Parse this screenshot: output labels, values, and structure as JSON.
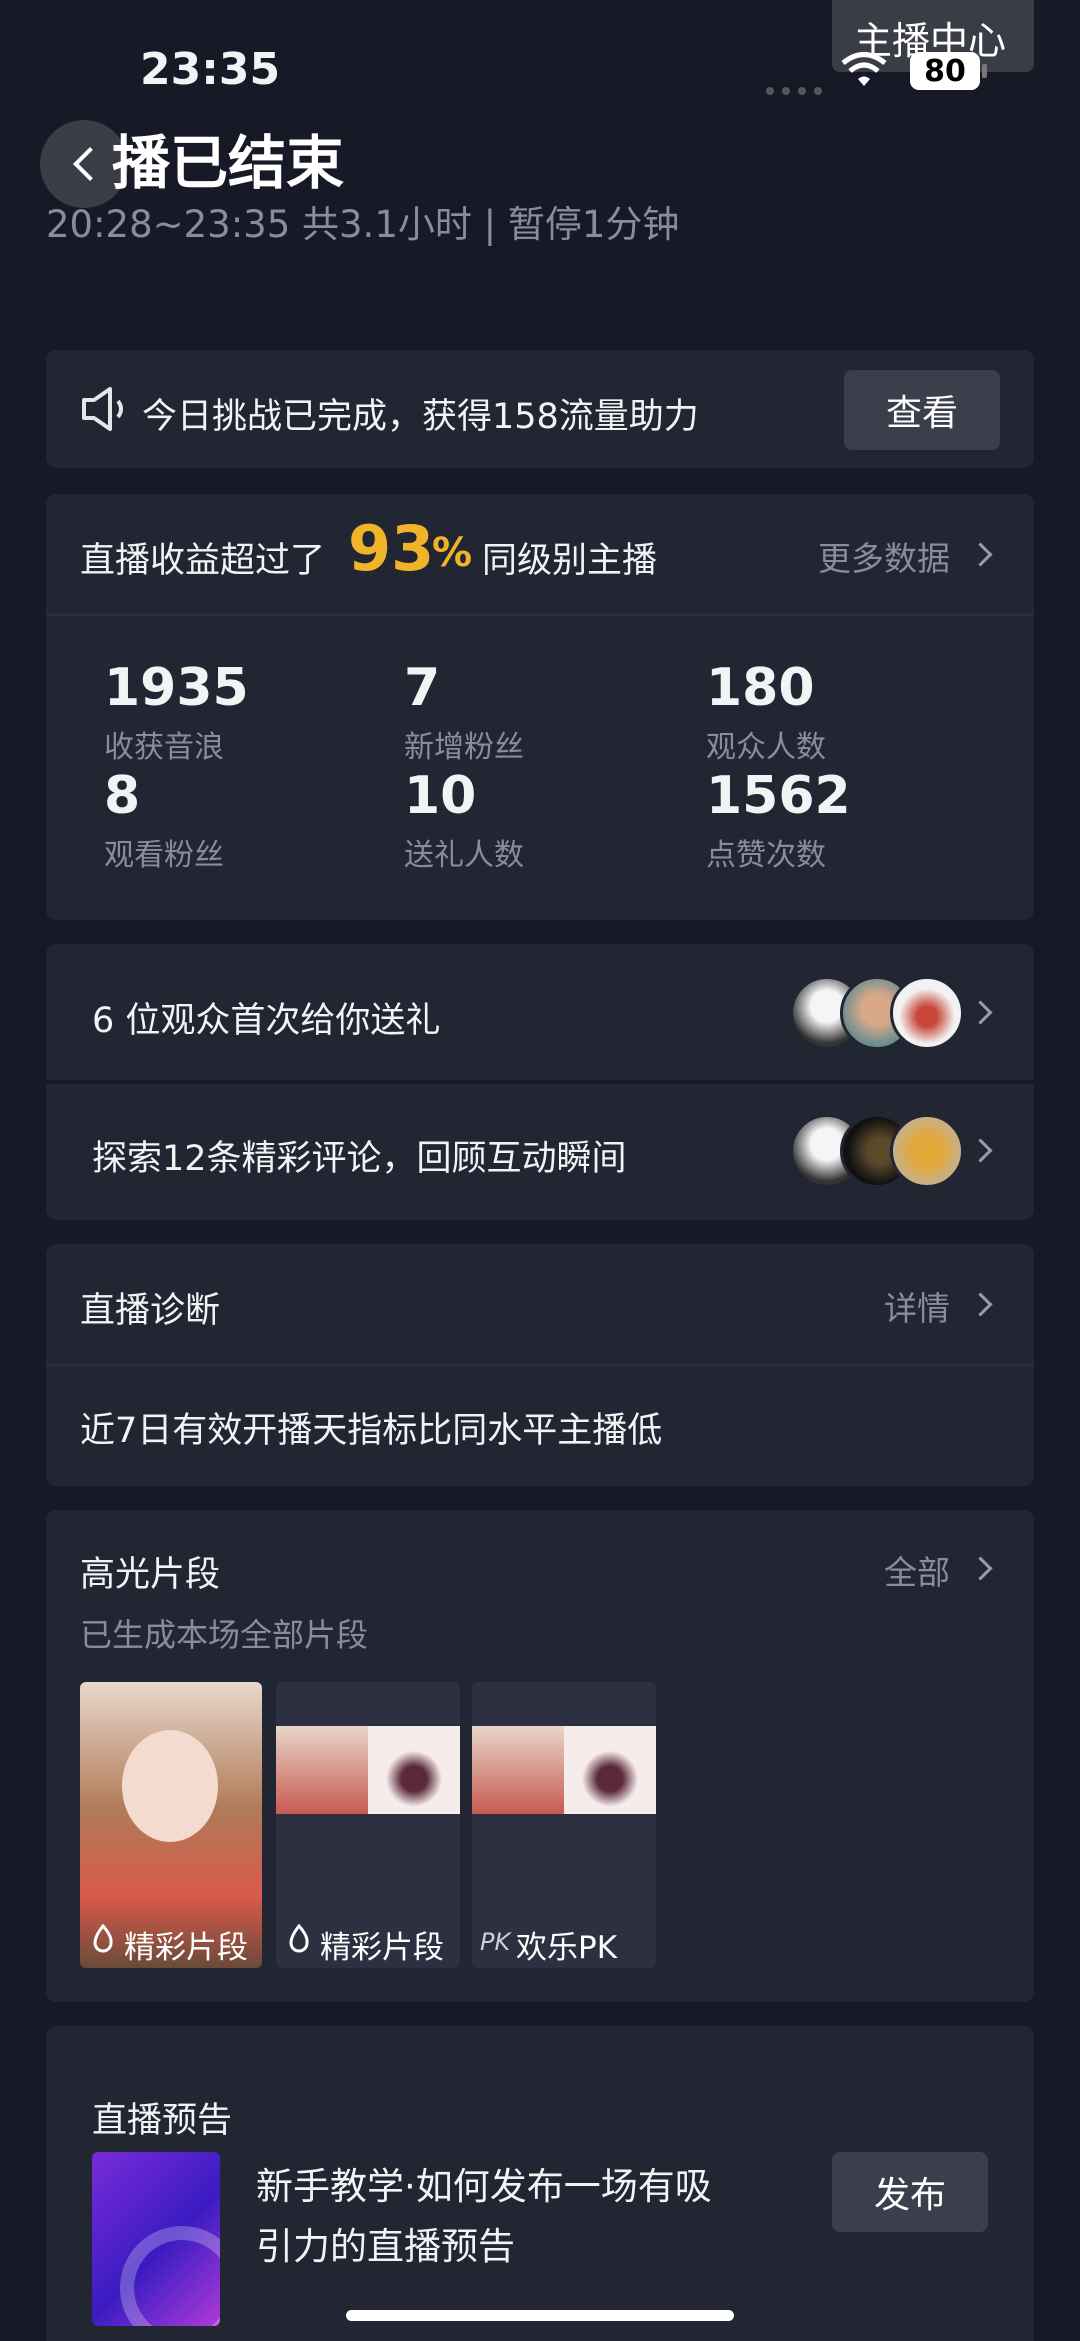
{
  "status_bar": {
    "time": "23:35",
    "battery": "80"
  },
  "header": {
    "anchor_center": "主播中心",
    "title": "播已结束",
    "subtitle": "20:28~23:35 共3.1小时 | 暂停1分钟"
  },
  "challenge": {
    "text": "今日挑战已完成，获得158流量助力",
    "button": "查看"
  },
  "earnings": {
    "prefix": "直播收益超过了",
    "percent": "93",
    "percent_sign": "%",
    "suffix": "同级别主播",
    "more": "更多数据",
    "stats": [
      {
        "value": "1935",
        "label": "收获音浪"
      },
      {
        "value": "7",
        "label": "新增粉丝"
      },
      {
        "value": "180",
        "label": "观众人数"
      },
      {
        "value": "8",
        "label": "观看粉丝"
      },
      {
        "value": "10",
        "label": "送礼人数"
      },
      {
        "value": "1562",
        "label": "点赞次数"
      }
    ]
  },
  "gifts_row": {
    "text": "6 位观众首次给你送礼"
  },
  "comments_row": {
    "text": "探索12条精彩评论，回顾互动瞬间"
  },
  "diagnosis": {
    "title": "直播诊断",
    "detail": "详情",
    "message": "近7日有效开播天指标比同水平主播低"
  },
  "highlights": {
    "title": "高光片段",
    "all": "全部",
    "subtitle": "已生成本场全部片段",
    "clips": [
      {
        "label": "精彩片段",
        "icon": "flame-icon"
      },
      {
        "label": "精彩片段",
        "icon": "flame-icon"
      },
      {
        "label": "欢乐PK",
        "badge": "PK"
      }
    ]
  },
  "preview": {
    "title": "直播预告",
    "line1": "新手教学·如何发布一场有吸",
    "line2": "引力的直播预告",
    "button": "发布"
  },
  "colors": {
    "background": "#171a26",
    "card": "#222532",
    "accent": "#f0b429",
    "muted": "#8a8d99"
  }
}
